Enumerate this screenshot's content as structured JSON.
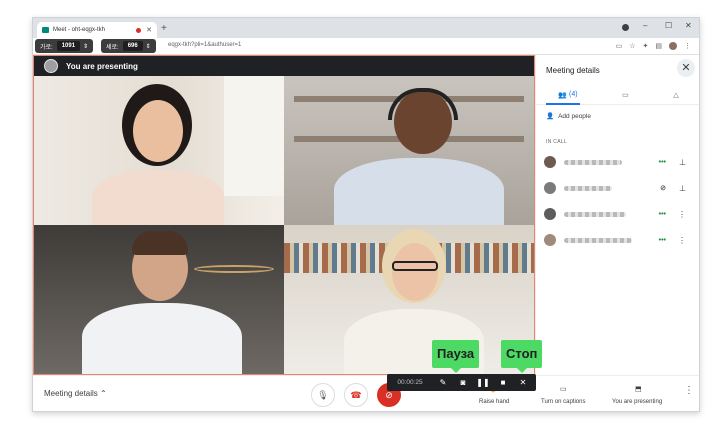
{
  "browser": {
    "tab_title": "Meet - oht-eqgx-tkh",
    "url_text": "eqgx-tkh?pli=1&authuser=1",
    "width_label": "가로:",
    "width_value": "1091",
    "height_label": "세로:",
    "height_value": "696"
  },
  "stage": {
    "presenting_text": "You are presenting"
  },
  "panel": {
    "title": "Meeting details",
    "people_count": "(4)",
    "add_people": "Add people",
    "in_call": "IN CALL"
  },
  "bottom": {
    "meeting_details": "Meeting details",
    "raise_hand": "Raise hand",
    "captions": "Turn on captions",
    "presenting": "You are presenting"
  },
  "recorder": {
    "time": "00:00:25",
    "pause_tip": "Пауза",
    "stop_tip": "Стоп"
  },
  "colors": {
    "accent": "#1a73e8",
    "end_call": "#d93025",
    "tooltip": "#4cd964"
  }
}
